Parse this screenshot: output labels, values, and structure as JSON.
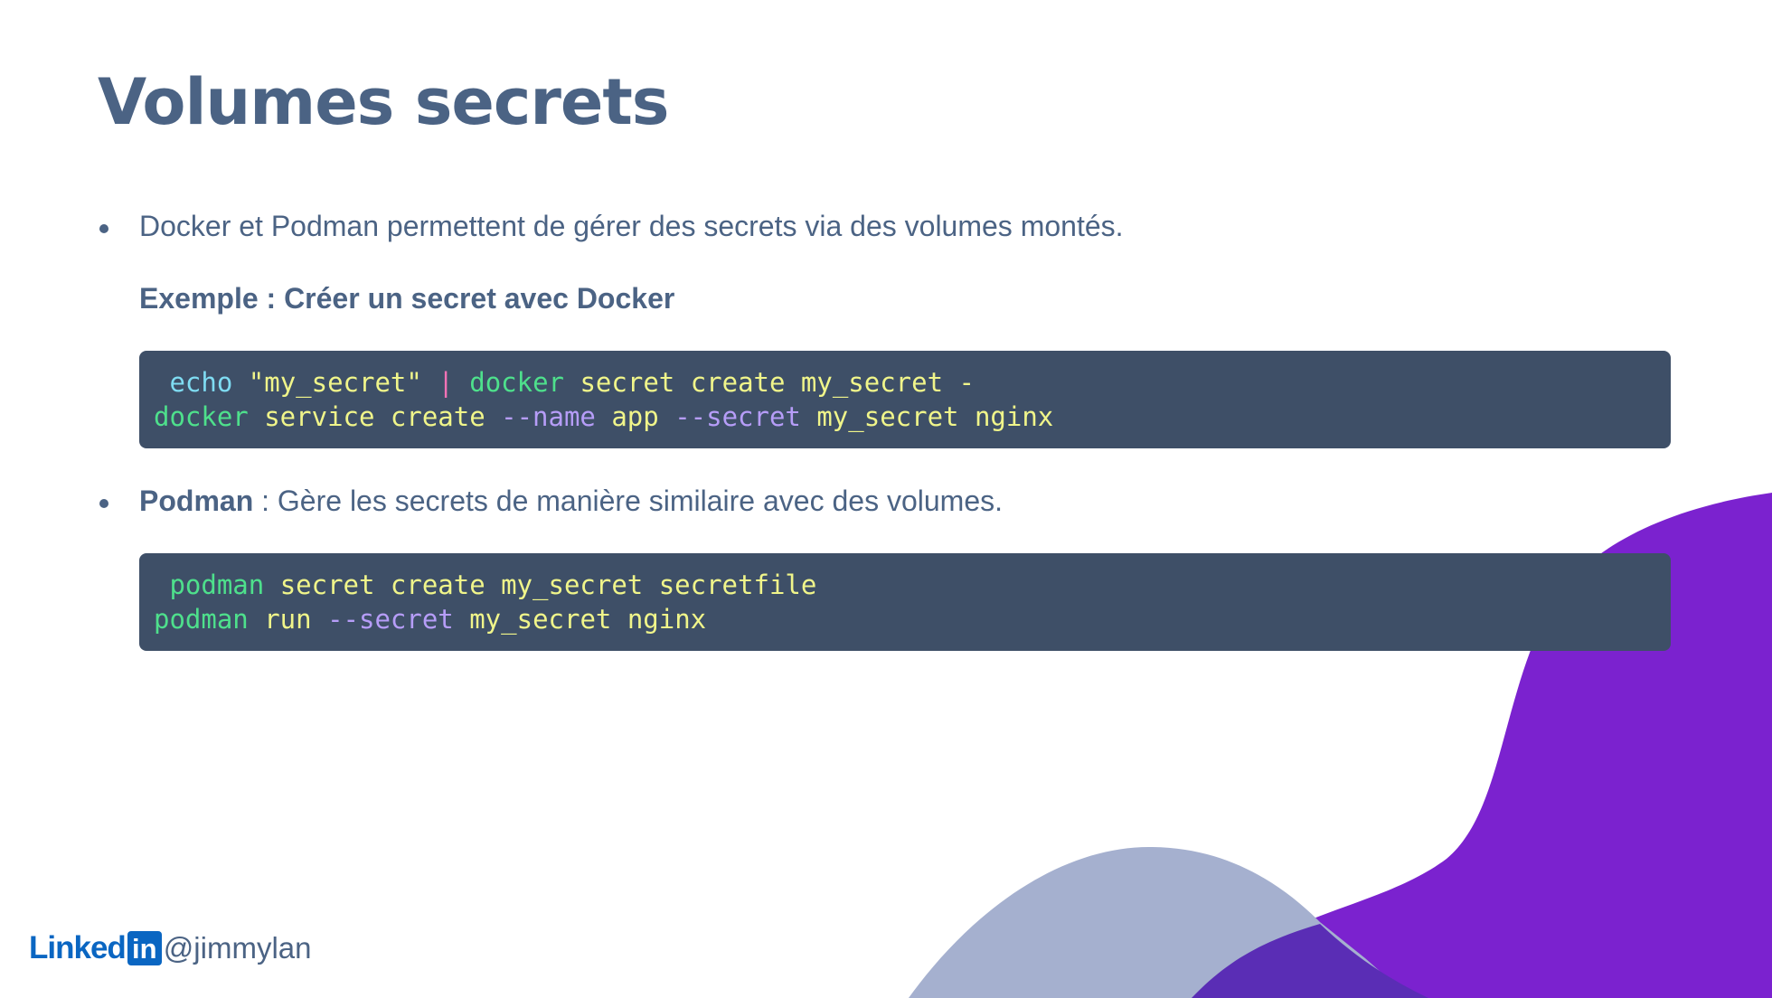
{
  "slide": {
    "title": "Volumes secrets",
    "bullets": [
      {
        "text": "Docker et Podman permettent de gérer des secrets via des volumes montés."
      },
      {
        "bold": "Podman",
        "text": " : Gère les secrets de manière similaire avec des volumes."
      }
    ],
    "example_heading": "Exemple : Créer un secret avec Docker",
    "code_blocks": [
      {
        "lines": [
          [
            {
              "t": " ",
              "k": "arg"
            },
            {
              "t": "echo",
              "k": "builtin"
            },
            {
              "t": " ",
              "k": "arg"
            },
            {
              "t": "\"my_secret\"",
              "k": "str"
            },
            {
              "t": " ",
              "k": "arg"
            },
            {
              "t": "|",
              "k": "pipe"
            },
            {
              "t": " ",
              "k": "arg"
            },
            {
              "t": "docker",
              "k": "cmd"
            },
            {
              "t": " secret create my_secret -",
              "k": "arg"
            }
          ],
          [
            {
              "t": "docker",
              "k": "cmd"
            },
            {
              "t": " service create ",
              "k": "arg"
            },
            {
              "t": "--name",
              "k": "flag"
            },
            {
              "t": " app ",
              "k": "arg"
            },
            {
              "t": "--secret",
              "k": "flag"
            },
            {
              "t": " my_secret nginx",
              "k": "arg"
            }
          ]
        ]
      },
      {
        "lines": [
          [
            {
              "t": " ",
              "k": "arg"
            },
            {
              "t": "podman",
              "k": "cmd"
            },
            {
              "t": " secret create my_secret secretfile",
              "k": "arg"
            }
          ],
          [
            {
              "t": "podman",
              "k": "cmd"
            },
            {
              "t": " run ",
              "k": "arg"
            },
            {
              "t": "--secret",
              "k": "flag"
            },
            {
              "t": " my_secret nginx",
              "k": "arg"
            }
          ]
        ]
      }
    ]
  },
  "footer": {
    "linkedin_word": "Linked",
    "linkedin_box": "in",
    "handle": "@jimmylan"
  },
  "colors": {
    "text": "#4b6384",
    "code_background": "#3e4f67",
    "accent_purple": "#7b22cf",
    "accent_lavender": "#a5b0cf",
    "linkedin_blue": "#0a66c2"
  },
  "icons": {
    "linkedin": "linkedin-logo"
  }
}
